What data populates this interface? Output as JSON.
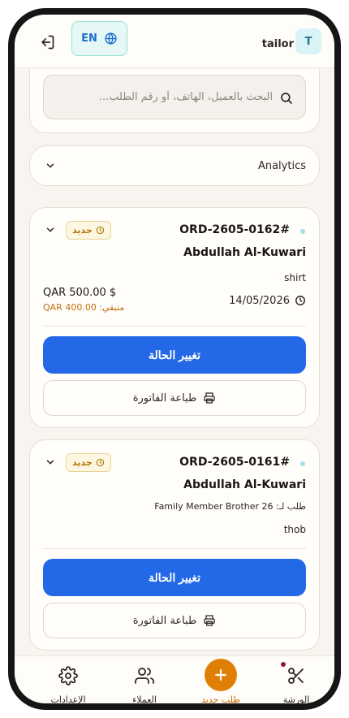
{
  "header": {
    "language_label": "EN",
    "shop_name": "tailor",
    "avatar_initial": "T"
  },
  "search": {
    "placeholder": "البحث بالعميل، الهاتف، أو رقم الطلب..."
  },
  "analytics": {
    "label": "Analytics"
  },
  "orders": [
    {
      "id": "ORD-2605-0162#",
      "status": "جديد",
      "customer": "Abdullah Al-Kuwari",
      "garment": "shirt",
      "date": "14/05/2026",
      "total": "QAR 500.00 $",
      "remaining": "متبقي: QAR 400.00",
      "change_status_label": "تغيير الحالة",
      "print_label": "طباعة الفاتورة"
    },
    {
      "id": "ORD-2605-0161#",
      "status": "جديد",
      "customer": "Abdullah Al-Kuwari",
      "family_member": "طلب لـ: Family Member Brother 26",
      "garment": "thob",
      "change_status_label": "تغيير الحالة",
      "print_label": "طباعة الفاتورة"
    }
  ],
  "nav": {
    "settings": "الإعدادات",
    "customers": "العملاء",
    "new_order": "طلب جديد",
    "workshop": "الورشة"
  },
  "colors": {
    "primary": "#2368e6",
    "accent": "#e07f06",
    "badge_text": "#b07800",
    "remaining_text": "#c06f0d"
  }
}
